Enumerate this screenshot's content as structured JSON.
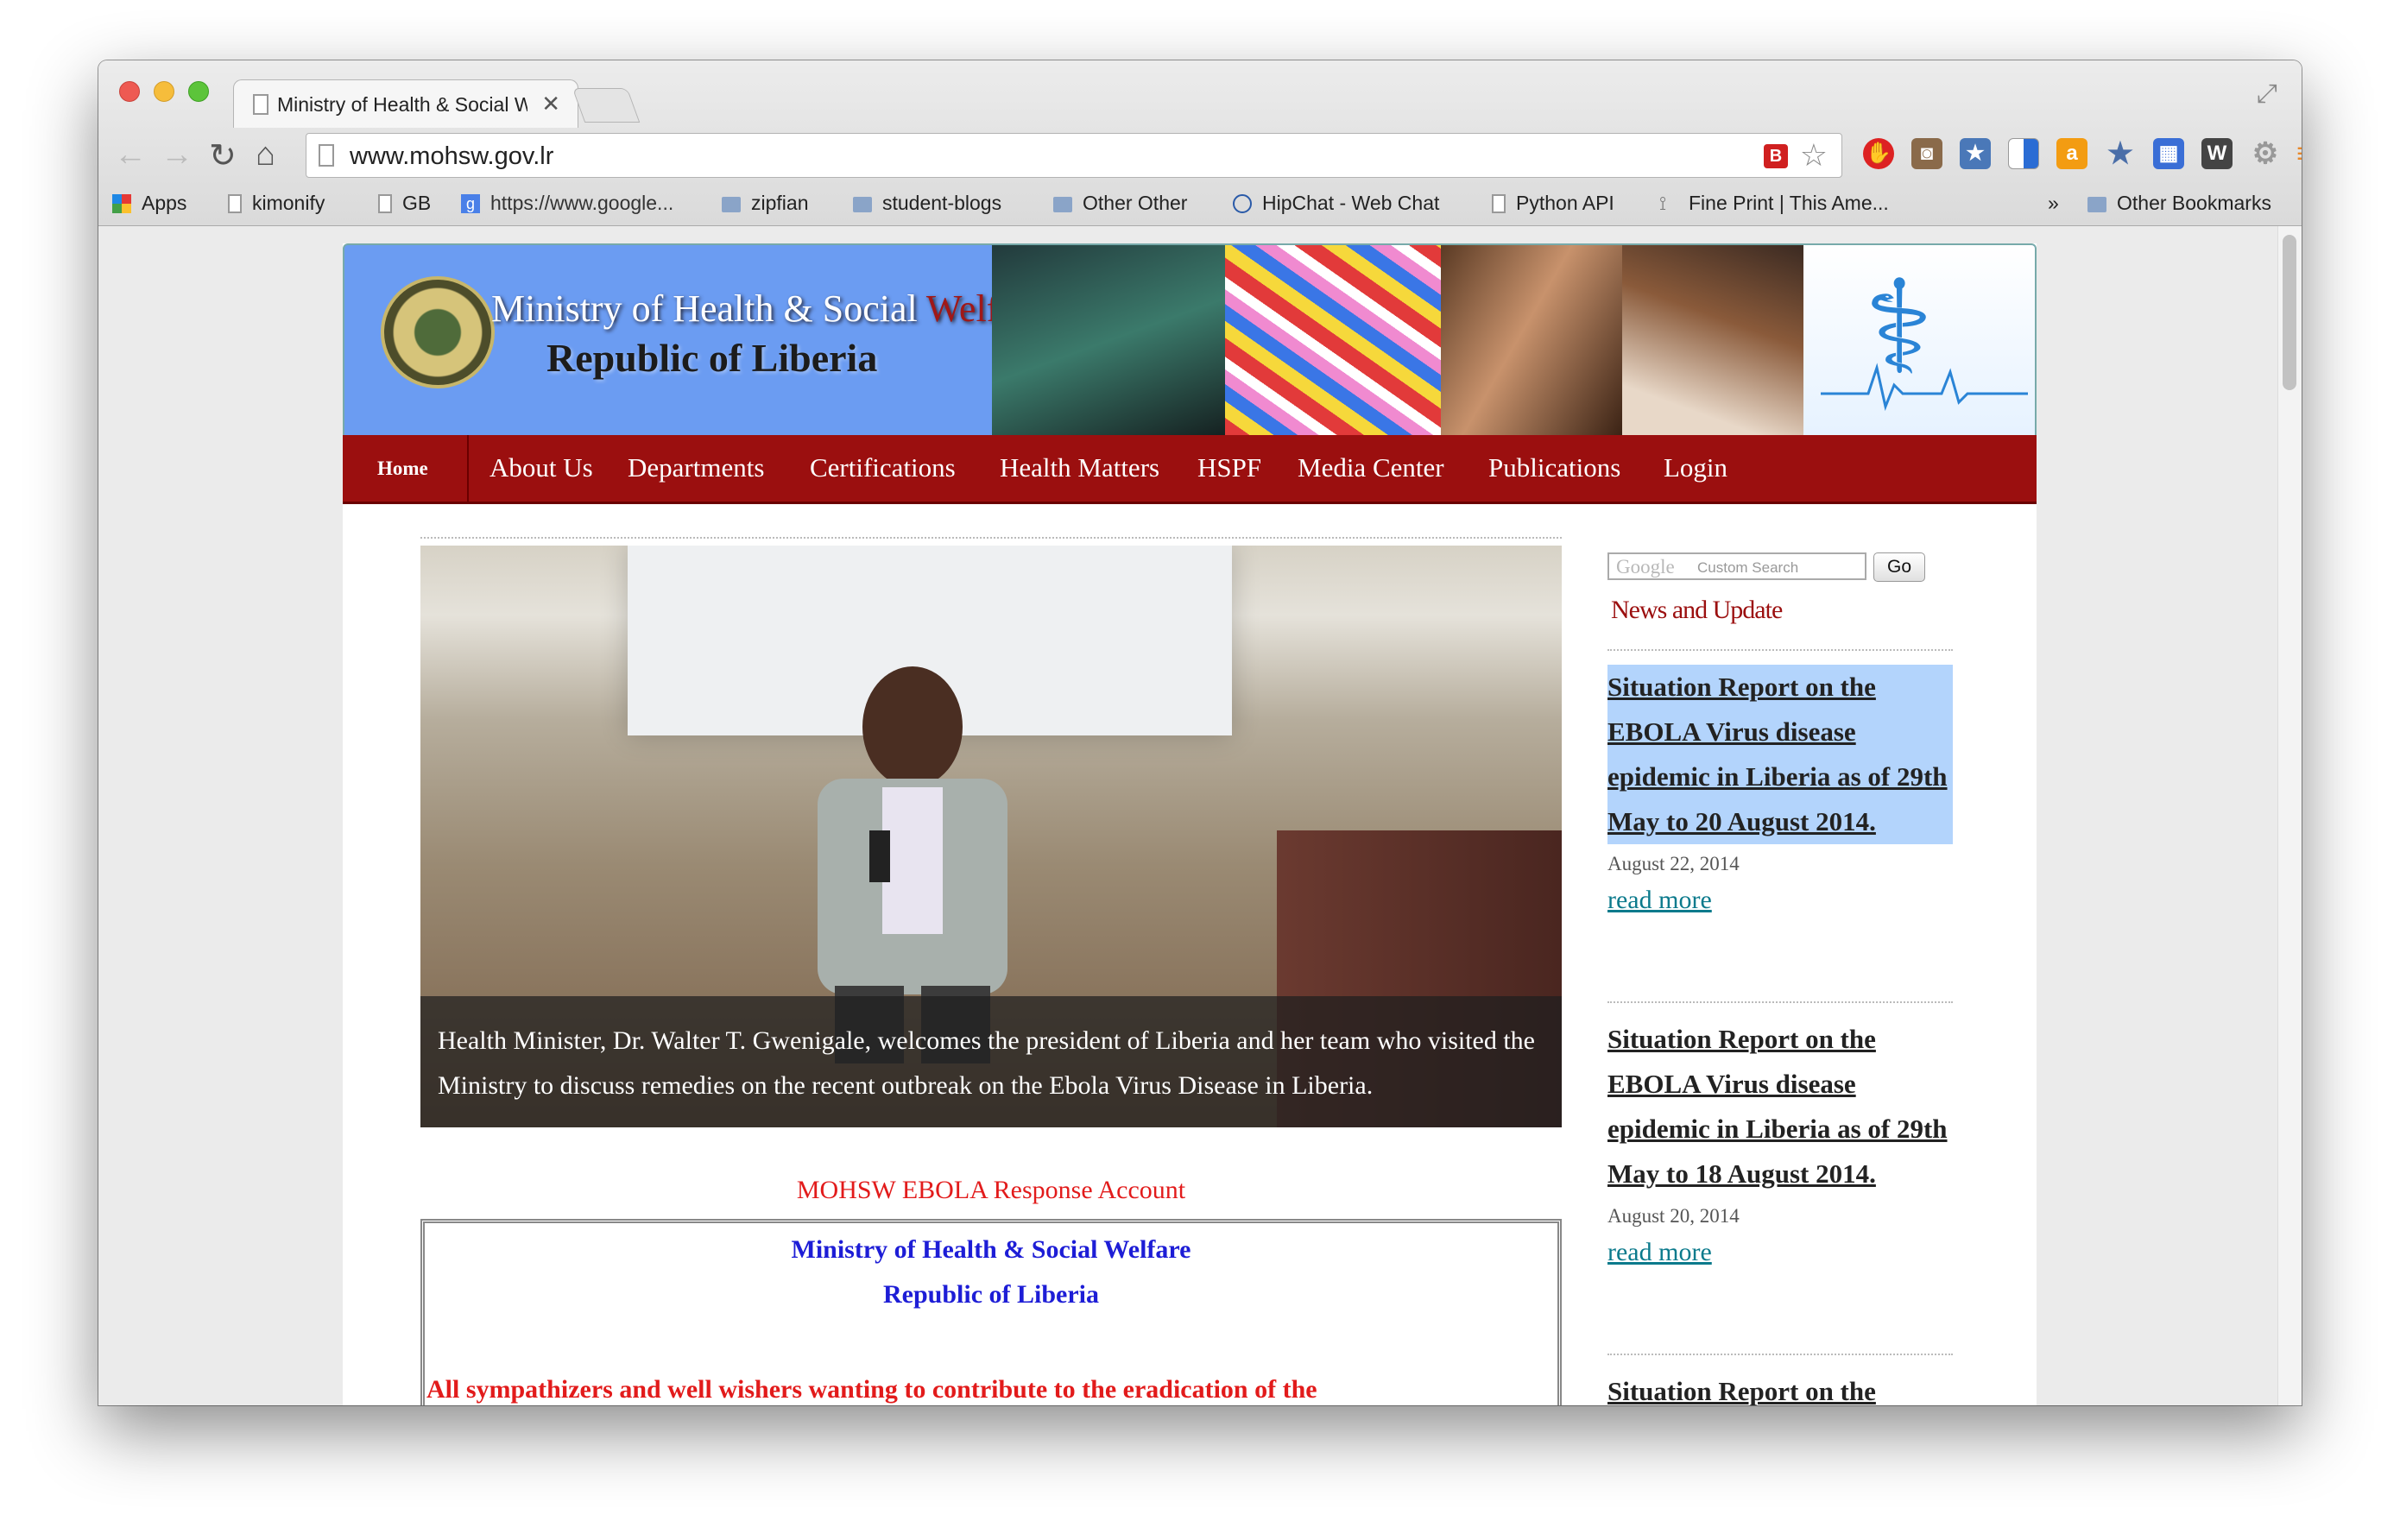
{
  "browser": {
    "tab_title": "Ministry of Health & Social Welfare",
    "url": "www.mohsw.gov.lr",
    "bookmarks": [
      {
        "label": "Apps",
        "icon": "apps-grid-icon"
      },
      {
        "label": "kimonify",
        "icon": "page-icon"
      },
      {
        "label": "GB",
        "icon": "page-icon"
      },
      {
        "label": "https://www.google...",
        "icon": "google-icon"
      },
      {
        "label": "zipfian",
        "icon": "folder-icon"
      },
      {
        "label": "student-blogs",
        "icon": "folder-icon"
      },
      {
        "label": "Other Other",
        "icon": "folder-icon"
      },
      {
        "label": "HipChat - Web Chat",
        "icon": "hipchat-icon"
      },
      {
        "label": "Python API",
        "icon": "page-icon"
      },
      {
        "label": "Fine Print | This Ame...",
        "icon": "rss-icon"
      }
    ],
    "overflow_label": "»",
    "other_bookmarks": "Other Bookmarks"
  },
  "site": {
    "banner_line1_a": "Ministry of Health & Social ",
    "banner_line1_b": "Welfare",
    "banner_line2": "Republic of Liberia",
    "nav": [
      "Home",
      "About Us",
      "Departments",
      "Certifications",
      "Health Matters",
      "HSPF",
      "Media Center",
      "Publications",
      "Login"
    ],
    "slide_caption": "Health Minister, Dr. Walter T. Gwenigale, welcomes the president of Liberia and her team who visited the Ministry to discuss remedies on the recent outbreak on the Ebola Virus Disease in Liberia.",
    "account_title": "MOHSW EBOLA Response Account",
    "account_line1": "Ministry of Health & Social Welfare",
    "account_line2": "Republic of Liberia",
    "account_line3": "All sympathizers and well wishers wanting to contribute to the eradication of the",
    "search_google": "Google",
    "search_placeholder": "Custom Search",
    "search_go": "Go",
    "news_heading": "News and Update",
    "news": [
      {
        "title": "Situation Report on the EBOLA Virus disease epidemic in Liberia as of 29th May to 20 August 2014.",
        "date": "August 22, 2014",
        "more": "read more"
      },
      {
        "title": "Situation Report on the EBOLA Virus disease epidemic in Liberia as of 29th May to 18 August 2014.",
        "date": "August 20, 2014",
        "more": "read more"
      },
      {
        "title": "Situation Report on the",
        "date": "",
        "more": ""
      }
    ]
  }
}
